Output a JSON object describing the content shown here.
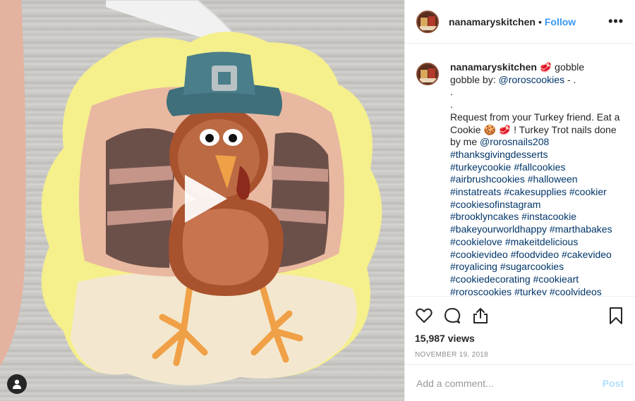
{
  "post": {
    "username": "nanamaryskitchen",
    "dot": "•",
    "follow_label": "Follow",
    "more_label": "•••"
  },
  "caption": {
    "username": "nanamaryskitchen",
    "line1_after_name": " 🥩 gobble",
    "line2_prefix": "gobble by: ",
    "line2_mention": "@roroscookies",
    "line2_suffix": " - .",
    "dot_lines": [
      ".",
      "."
    ],
    "body_a": "Request from your Turkey friend. Eat a Cookie 🍪 🥩 ! Turkey Trot nails done by me ",
    "body_mention": "@rorosnails208",
    "hashtag_lines": [
      "#thanksgivingdesserts",
      "#turkeycookie #fallcookies",
      "#airbrushcookies #halloween",
      "#instatreats #cakesupplies #cookier",
      "#cookiesofinstagram",
      "#brooklyncakes #instacookie",
      "#bakeyourworldhappy #marthabakes",
      "#cookielove #makeitdelicious",
      "#cookievideo #foodvideo #cakevideo",
      "#royalicing #sugarcookies",
      "#cookiedecorating #cookieart",
      "#roroscookies #turkey #coolvideos"
    ]
  },
  "stats": {
    "views": "15,987 views",
    "date": "NOVEMBER 19, 2018"
  },
  "comment": {
    "placeholder": "Add a comment...",
    "post_label": "Post"
  },
  "icons": {
    "like": "heart-icon",
    "comment": "comment-icon",
    "share": "share-icon",
    "save": "bookmark-icon",
    "play": "play-icon",
    "user_tag": "user-icon"
  },
  "colors": {
    "link": "#003569",
    "follow": "#3897f0",
    "post_disabled": "#b2dffc"
  }
}
